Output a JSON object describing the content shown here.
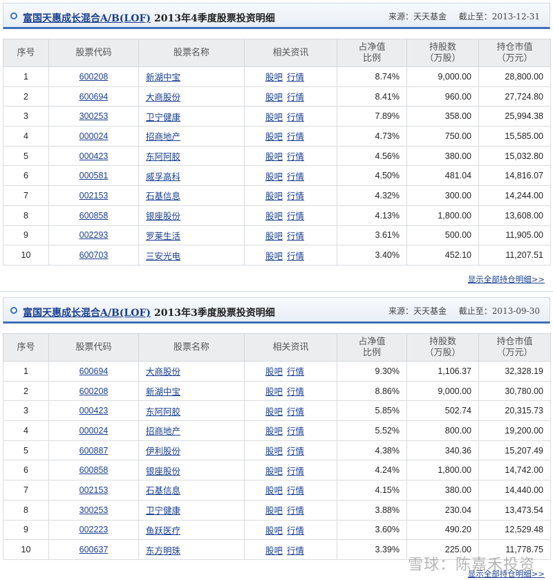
{
  "columns": {
    "seq": "序号",
    "code": "股票代码",
    "name": "股票名称",
    "info": "相关资讯",
    "pct1": "占净值",
    "pct2": "比例",
    "shares1": "持股数",
    "shares2": "（万股）",
    "value1": "持仓市值",
    "value2": "（万元）"
  },
  "info_links": {
    "bar": "股吧",
    "quote": "行情"
  },
  "panels": [
    {
      "fund_link": "富国天惠成长混合A/B(LOF)",
      "title": "2013年4季度股票投资明细",
      "source": "来源：天天基金",
      "as_of": "截止至：2013-12-31",
      "show_all": "显示全部持仓明细>>",
      "rows": [
        {
          "seq": "1",
          "code": "600208",
          "name": "新湖中宝",
          "pct": "8.74%",
          "shares": "9,000.00",
          "value": "28,800.00"
        },
        {
          "seq": "2",
          "code": "600694",
          "name": "大商股份",
          "pct": "8.41%",
          "shares": "960.00",
          "value": "27,724.80"
        },
        {
          "seq": "3",
          "code": "300253",
          "name": "卫宁健康",
          "pct": "7.89%",
          "shares": "358.00",
          "value": "25,994.38"
        },
        {
          "seq": "4",
          "code": "000024",
          "name": "招商地产",
          "pct": "4.73%",
          "shares": "750.00",
          "value": "15,585.00"
        },
        {
          "seq": "5",
          "code": "000423",
          "name": "东阿阿胶",
          "pct": "4.56%",
          "shares": "380.00",
          "value": "15,032.80"
        },
        {
          "seq": "6",
          "code": "000581",
          "name": "威孚高科",
          "pct": "4.50%",
          "shares": "481.04",
          "value": "14,816.07"
        },
        {
          "seq": "7",
          "code": "002153",
          "name": "石基信息",
          "pct": "4.32%",
          "shares": "300.00",
          "value": "14,244.00"
        },
        {
          "seq": "8",
          "code": "600858",
          "name": "银座股份",
          "pct": "4.13%",
          "shares": "1,800.00",
          "value": "13,608.00"
        },
        {
          "seq": "9",
          "code": "002293",
          "name": "罗莱生活",
          "pct": "3.61%",
          "shares": "500.00",
          "value": "11,905.00"
        },
        {
          "seq": "10",
          "code": "600703",
          "name": "三安光电",
          "pct": "3.40%",
          "shares": "452.10",
          "value": "11,207.51"
        }
      ]
    },
    {
      "fund_link": "富国天惠成长混合A/B(LOF)",
      "title": "2013年3季度股票投资明细",
      "source": "来源：天天基金",
      "as_of": "截止至：2013-09-30",
      "show_all": "显示全部持仓明细>>",
      "rows": [
        {
          "seq": "1",
          "code": "600694",
          "name": "大商股份",
          "pct": "9.30%",
          "shares": "1,106.37",
          "value": "32,328.19"
        },
        {
          "seq": "2",
          "code": "600208",
          "name": "新湖中宝",
          "pct": "8.86%",
          "shares": "9,000.00",
          "value": "30,780.00"
        },
        {
          "seq": "3",
          "code": "000423",
          "name": "东阿阿胶",
          "pct": "5.85%",
          "shares": "502.74",
          "value": "20,315.73"
        },
        {
          "seq": "4",
          "code": "000024",
          "name": "招商地产",
          "pct": "5.52%",
          "shares": "800.00",
          "value": "19,200.00"
        },
        {
          "seq": "5",
          "code": "600887",
          "name": "伊利股份",
          "pct": "4.38%",
          "shares": "340.36",
          "value": "15,207.49"
        },
        {
          "seq": "6",
          "code": "600858",
          "name": "银座股份",
          "pct": "4.24%",
          "shares": "1,800.00",
          "value": "14,742.00"
        },
        {
          "seq": "7",
          "code": "002153",
          "name": "石基信息",
          "pct": "4.15%",
          "shares": "380.00",
          "value": "14,440.00"
        },
        {
          "seq": "8",
          "code": "300253",
          "name": "卫宁健康",
          "pct": "3.88%",
          "shares": "230.04",
          "value": "13,473.54"
        },
        {
          "seq": "9",
          "code": "002223",
          "name": "鱼跃医疗",
          "pct": "3.60%",
          "shares": "490.20",
          "value": "12,529.48"
        },
        {
          "seq": "10",
          "code": "600637",
          "name": "东方明珠",
          "pct": "3.39%",
          "shares": "225.00",
          "value": "11,778.75"
        }
      ]
    }
  ],
  "watermark": "雪球：陈嘉禾投资"
}
